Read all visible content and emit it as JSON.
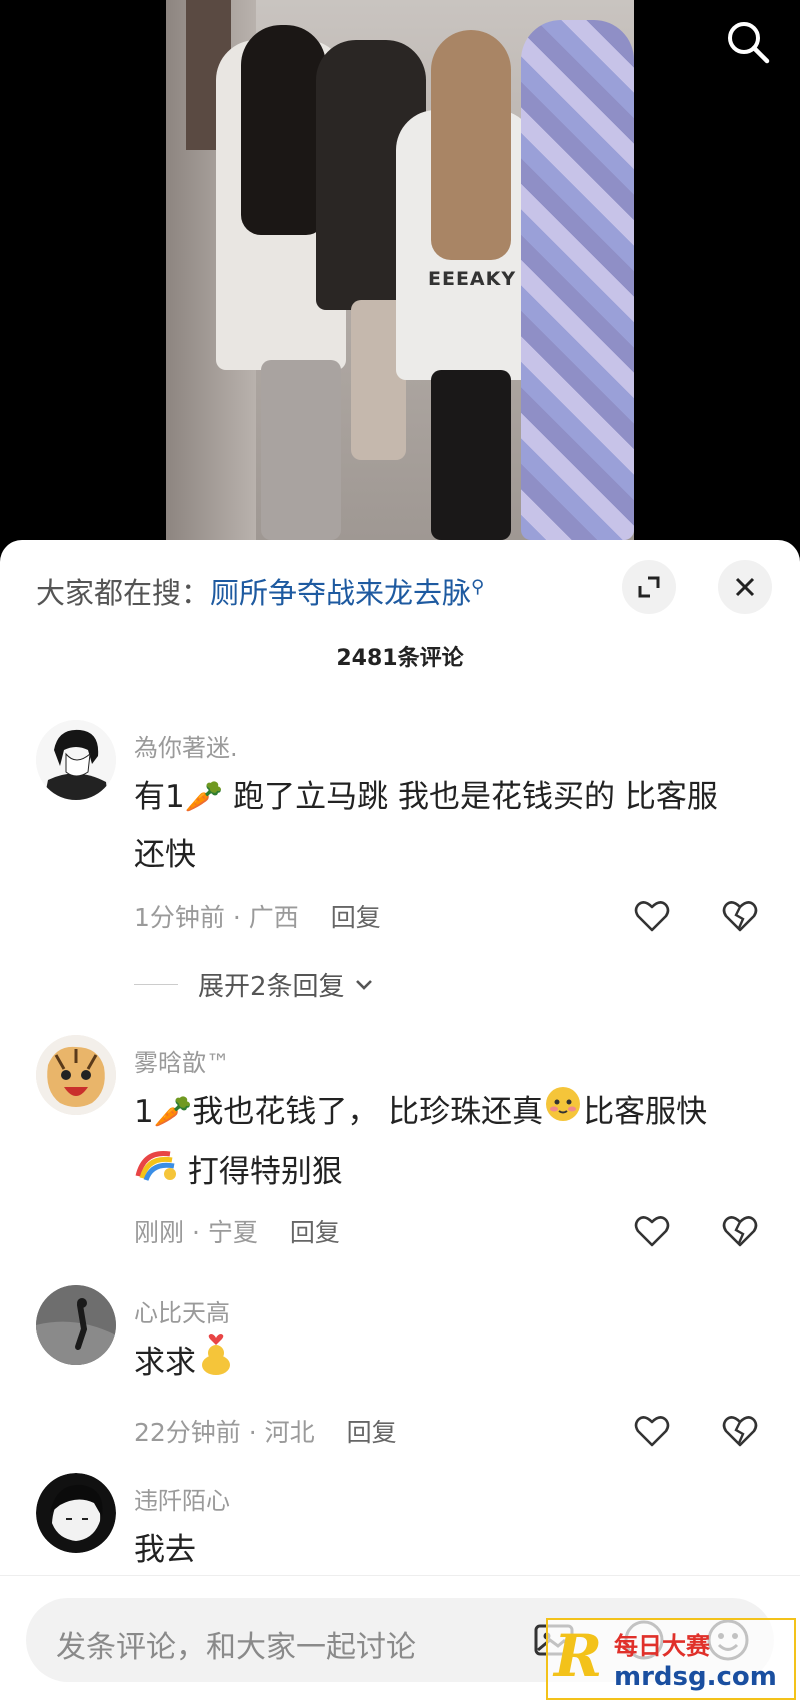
{
  "search_bar": {
    "prefix": "大家都在搜：",
    "query": "厕所争夺战来龙去脉"
  },
  "video": {
    "shirt_text": "EEEAKY"
  },
  "comments_header": {
    "count": "2481条评论"
  },
  "comments": [
    {
      "username": "為你著迷.",
      "text_line1": "有1🥕 跑了立马跳 我也是花钱买的 比客服",
      "text_line2": "还快",
      "time": "1分钟前 · 广西",
      "reply_label": "回复",
      "expand": "展开2条回复"
    },
    {
      "username": "雾晗歆™",
      "text_line1a": "1🥕我也花钱了， 比珍珠还真",
      "text_line1b": "比客服快",
      "text_line2": "打得特别狠",
      "time": "刚刚 · 宁夏",
      "reply_label": "回复"
    },
    {
      "username": "心比天高",
      "text": "求求",
      "time": "22分钟前 · 河北",
      "reply_label": "回复"
    },
    {
      "username": "违阡陌心",
      "text": "我去"
    }
  ],
  "input": {
    "placeholder": "发条评论，和大家一起讨论"
  },
  "watermark": {
    "line1": "每日大赛",
    "line2": "mrdsg.com",
    "logo": "R"
  }
}
